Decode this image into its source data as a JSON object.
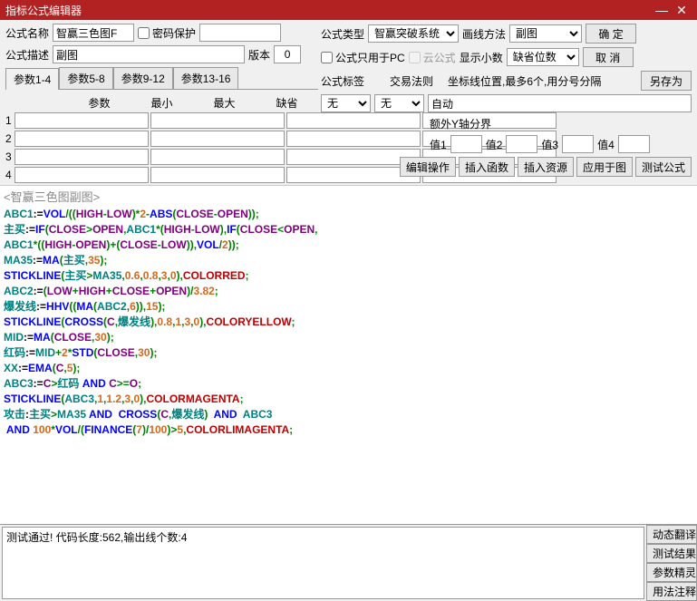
{
  "window": {
    "title": "指标公式编辑器"
  },
  "labels": {
    "name": "公式名称",
    "pwd": "密码保护",
    "type": "公式类型",
    "drawMethod": "画线方法",
    "ok": "确  定",
    "desc": "公式描述",
    "version": "版本",
    "pcOnly": "公式只用于PC",
    "cloud": "云公式",
    "showDec": "显示小数",
    "cancel": "取  消",
    "saveAs": "另存为",
    "formulaTag": "公式标签",
    "tradeRule": "交易法则",
    "coordHint": "坐标线位置,最多6个,用分号分隔",
    "extraY": "额外Y轴分界",
    "v1": "值1",
    "v2": "值2",
    "v3": "值3",
    "v4": "值4",
    "editOp": "编辑操作",
    "insertFn": "插入函数",
    "insertRes": "插入资源",
    "applyChart": "应用于图",
    "testFormula": "测试公式",
    "dynTrans": "动态翻译",
    "testResult": "测试结果",
    "paramWiz": "参数精灵",
    "usage": "用法注释"
  },
  "tabs": {
    "t1": "参数1-4",
    "t2": "参数5-8",
    "t3": "参数9-12",
    "t4": "参数13-16"
  },
  "paramHdr": {
    "c1": "参数",
    "c2": "最小",
    "c3": "最大",
    "c4": "缺省"
  },
  "values": {
    "name": "智赢三色图F",
    "desc": "副图",
    "version": "0",
    "type": "智赢突破系统",
    "drawMethod": "副图",
    "showDec": "缺省位数",
    "tag": "无",
    "rule": "无",
    "coord": "自动"
  },
  "codeTitle": "<智赢三色图副图>",
  "status": "测试通过! 代码长度:562,输出线个数:4"
}
